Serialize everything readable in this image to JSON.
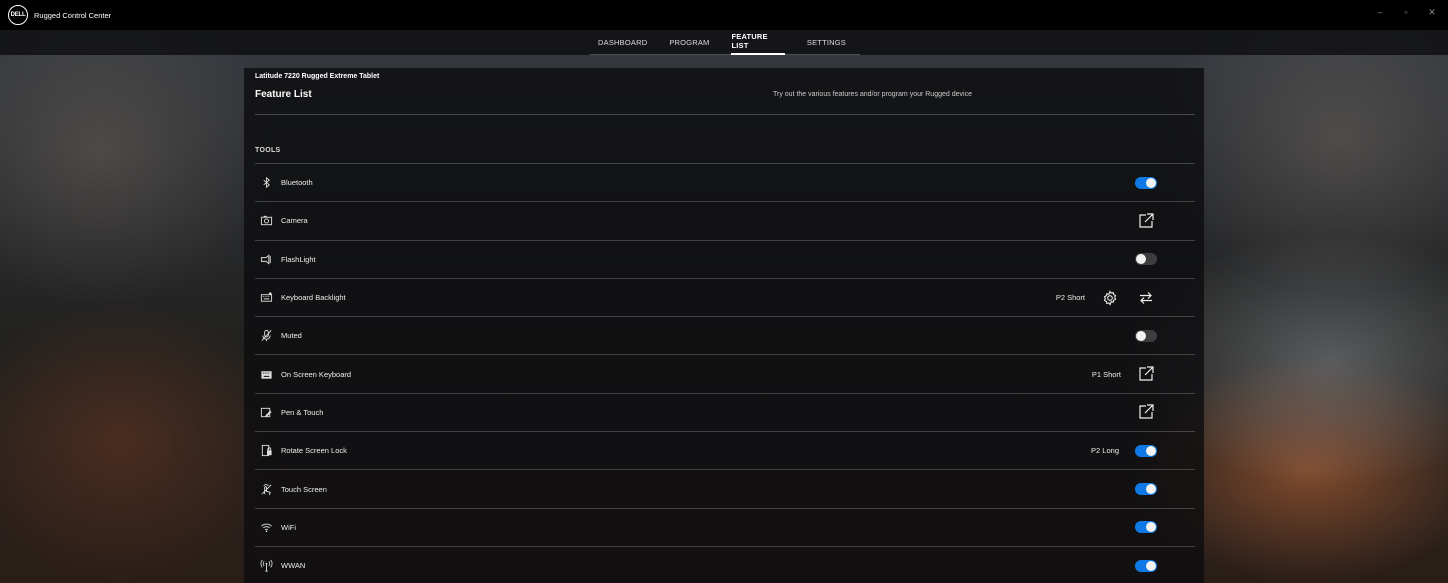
{
  "window": {
    "logo_text": "DELL",
    "title": "Rugged Control Center",
    "controls": {
      "minimize": "–",
      "restore": "▫",
      "close": "✕"
    }
  },
  "nav": {
    "tabs": [
      {
        "label": "DASHBOARD",
        "active": false
      },
      {
        "label": "PROGRAM",
        "active": false
      },
      {
        "label": "FEATURE LIST",
        "active": true
      },
      {
        "label": "SETTINGS",
        "active": false
      }
    ]
  },
  "panel": {
    "device_name": "Latitude 7220 Rugged Extreme Tablet",
    "title": "Feature List",
    "subtitle": "Try out the various features and/or program your Rugged device",
    "section": "TOOLS"
  },
  "features": [
    {
      "label": "Bluetooth",
      "icon": "bluetooth-icon",
      "control": "toggle",
      "state": true,
      "shortcut": ""
    },
    {
      "label": "Camera",
      "icon": "camera-icon",
      "control": "external",
      "shortcut": ""
    },
    {
      "label": "FlashLight",
      "icon": "flashlight-icon",
      "control": "toggle",
      "state": false,
      "shortcut": ""
    },
    {
      "label": "Keyboard Backlight",
      "icon": "keyboard-backlight-icon",
      "control": "cycle",
      "shortcut": "P2 Short",
      "settings": true
    },
    {
      "label": "Muted",
      "icon": "microphone-muted-icon",
      "control": "toggle",
      "state": false,
      "shortcut": ""
    },
    {
      "label": "On Screen Keyboard",
      "icon": "keyboard-icon",
      "control": "external",
      "shortcut": "P1 Short"
    },
    {
      "label": "Pen & Touch",
      "icon": "pen-touch-icon",
      "control": "external",
      "shortcut": ""
    },
    {
      "label": "Rotate Screen Lock",
      "icon": "rotate-lock-icon",
      "control": "toggle",
      "state": true,
      "shortcut": "P2 Long"
    },
    {
      "label": "Touch Screen",
      "icon": "touch-icon",
      "control": "toggle",
      "state": true,
      "shortcut": ""
    },
    {
      "label": "WiFi",
      "icon": "wifi-icon",
      "control": "toggle",
      "state": true,
      "shortcut": ""
    },
    {
      "label": "WWAN",
      "icon": "wwan-icon",
      "control": "toggle",
      "state": true,
      "shortcut": ""
    }
  ],
  "colors": {
    "toggle_on": "#0f7ae5",
    "toggle_off": "#3d3d3f",
    "titlebar": "#000000"
  }
}
